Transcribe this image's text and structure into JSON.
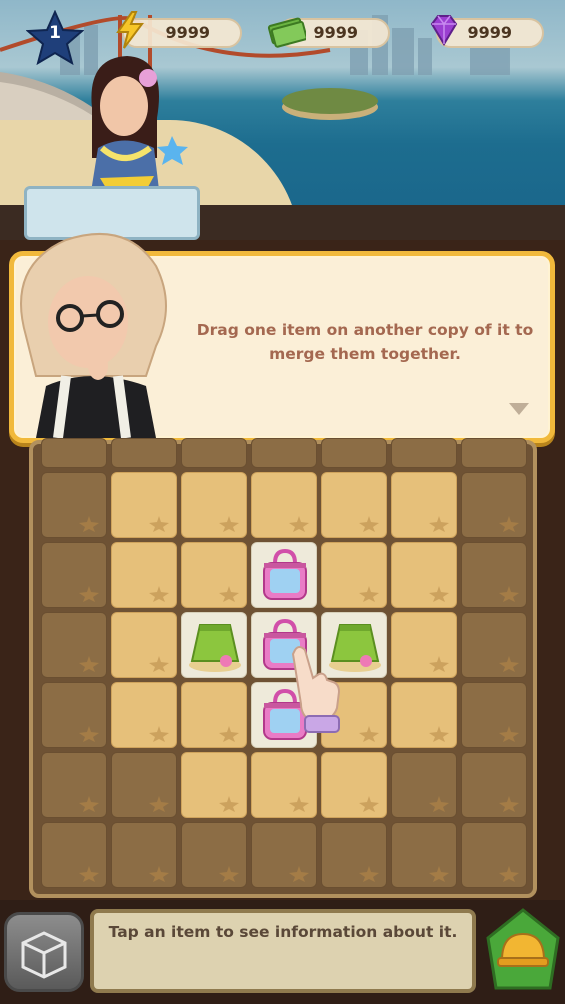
{
  "hud": {
    "level": "1",
    "energy": "9999",
    "cash": "9999",
    "gems": "9999"
  },
  "dialog": {
    "message": "Drag one item on another copy of it to merge them together."
  },
  "board": {
    "rows": 6,
    "cols": 7,
    "items": [
      {
        "name": "bag-item",
        "row": 1,
        "col": 3
      },
      {
        "name": "skirt-item",
        "row": 2,
        "col": 2
      },
      {
        "name": "bag-item",
        "row": 2,
        "col": 3
      },
      {
        "name": "skirt-item",
        "row": 2,
        "col": 4
      },
      {
        "name": "bag-item",
        "row": 3,
        "col": 3
      }
    ]
  },
  "info_panel": {
    "text": "Tap an item to see information about it."
  },
  "colors": {
    "dialog_border": "#f1b93b",
    "dialog_text": "#a46850",
    "tile_dark": "#8c6d45",
    "tile_lit": "#e6c07a"
  }
}
